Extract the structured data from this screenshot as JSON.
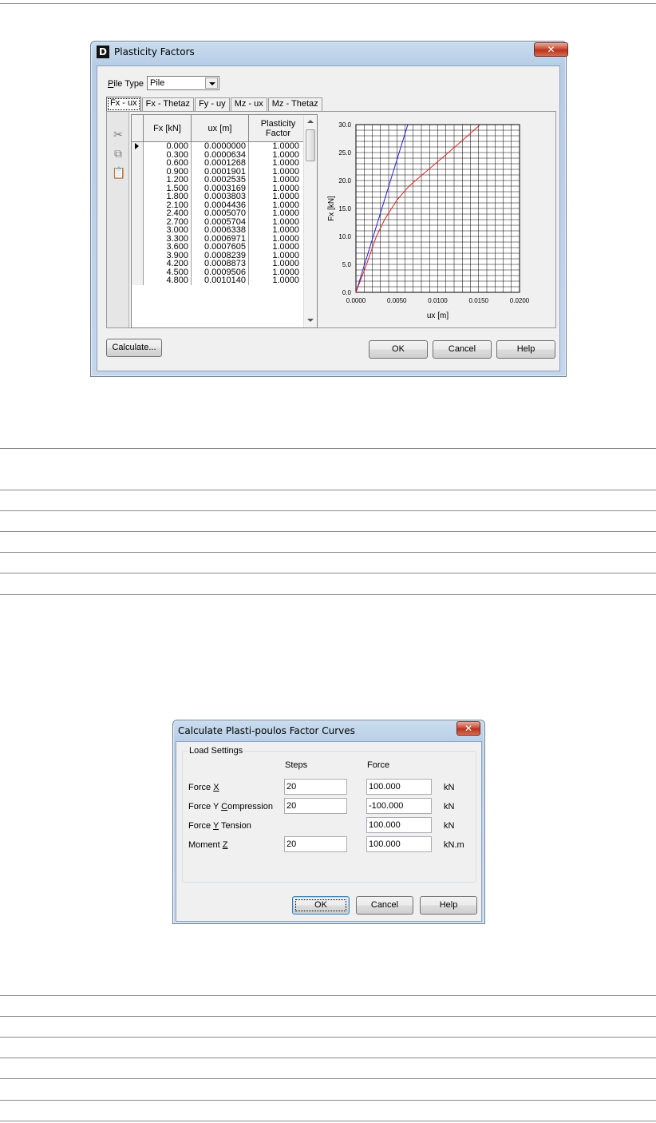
{
  "dialog1": {
    "title": "Plasticity Factors",
    "app_icon_letter": "D",
    "close_glyph": "✕",
    "pile_type": {
      "label_mnemonic": "P",
      "label_rest": "ile Type",
      "value": "Pile"
    },
    "tabs": [
      "Fx - ux",
      "Fx - Thetaz",
      "Fy - uy",
      "Mz - ux",
      "Mz - Thetaz"
    ],
    "active_tab": 0,
    "toolbar_icons": [
      "cut-icon",
      "copy-icon",
      "paste-icon"
    ],
    "table": {
      "headers": [
        "Fx [kN]",
        "ux [m]",
        "Plasticity Factor"
      ],
      "rows": [
        [
          "0.000",
          "0.0000000",
          "1.0000"
        ],
        [
          "0.300",
          "0.0000634",
          "1.0000"
        ],
        [
          "0.600",
          "0.0001268",
          "1.0000"
        ],
        [
          "0.900",
          "0.0001901",
          "1.0000"
        ],
        [
          "1.200",
          "0.0002535",
          "1.0000"
        ],
        [
          "1.500",
          "0.0003169",
          "1.0000"
        ],
        [
          "1.800",
          "0.0003803",
          "1.0000"
        ],
        [
          "2.100",
          "0.0004436",
          "1.0000"
        ],
        [
          "2.400",
          "0.0005070",
          "1.0000"
        ],
        [
          "2.700",
          "0.0005704",
          "1.0000"
        ],
        [
          "3.000",
          "0.0006338",
          "1.0000"
        ],
        [
          "3.300",
          "0.0006971",
          "1.0000"
        ],
        [
          "3.600",
          "0.0007605",
          "1.0000"
        ],
        [
          "3.900",
          "0.0008239",
          "1.0000"
        ],
        [
          "4.200",
          "0.0008873",
          "1.0000"
        ],
        [
          "4.500",
          "0.0009506",
          "1.0000"
        ],
        [
          "4.800",
          "0.0010140",
          "1.0000"
        ]
      ]
    },
    "calculate_button": "Calculate...",
    "ok_button": "OK",
    "cancel_button": "Cancel",
    "help_button": "Help"
  },
  "chart_data": {
    "type": "line",
    "title": "",
    "xlabel": "ux [m]",
    "ylabel": "Fx [kN]",
    "xlim": [
      0,
      0.02
    ],
    "ylim": [
      0,
      30
    ],
    "x_ticks": [
      "0.0000",
      "0.0050",
      "0.0100",
      "0.0150",
      "0.0200"
    ],
    "y_ticks": [
      "0.0",
      "5.0",
      "10.0",
      "15.0",
      "20.0",
      "25.0",
      "30.0"
    ],
    "grid": true,
    "series": [
      {
        "color": "#2020e0",
        "x": [
          0,
          0.00634
        ],
        "y": [
          0,
          30
        ]
      },
      {
        "color": "#e02020",
        "x": [
          0,
          0.0013,
          0.0025,
          0.0035,
          0.005,
          0.0065,
          0.0085,
          0.0105,
          0.0125,
          0.0152
        ],
        "y": [
          0,
          5,
          10,
          13,
          16.5,
          19,
          21.5,
          24,
          26.5,
          30
        ]
      }
    ]
  },
  "dialog2": {
    "title": "Calculate Plasti-poulos Factor Curves",
    "close_glyph": "✕",
    "group_label": "Load Settings",
    "col_steps": "Steps",
    "col_force": "Force",
    "rows": [
      {
        "label_pre": "Force ",
        "mnemonic": "X",
        "label_post": "",
        "steps": "20",
        "force": "100.000",
        "unit": "kN"
      },
      {
        "label_pre": "Force Y ",
        "mnemonic": "C",
        "label_post": "ompression",
        "steps": "20",
        "force": "-100.000",
        "unit": "kN"
      },
      {
        "label_pre": "Force ",
        "mnemonic": "Y",
        "label_post": " Tension",
        "steps": null,
        "force": "100.000",
        "unit": "kN"
      },
      {
        "label_pre": "Moment ",
        "mnemonic": "Z",
        "label_post": "",
        "steps": "20",
        "force": "100.000",
        "unit": "kN.m"
      }
    ],
    "ok_button": "OK",
    "cancel_button": "Cancel",
    "help_button": "Help"
  }
}
